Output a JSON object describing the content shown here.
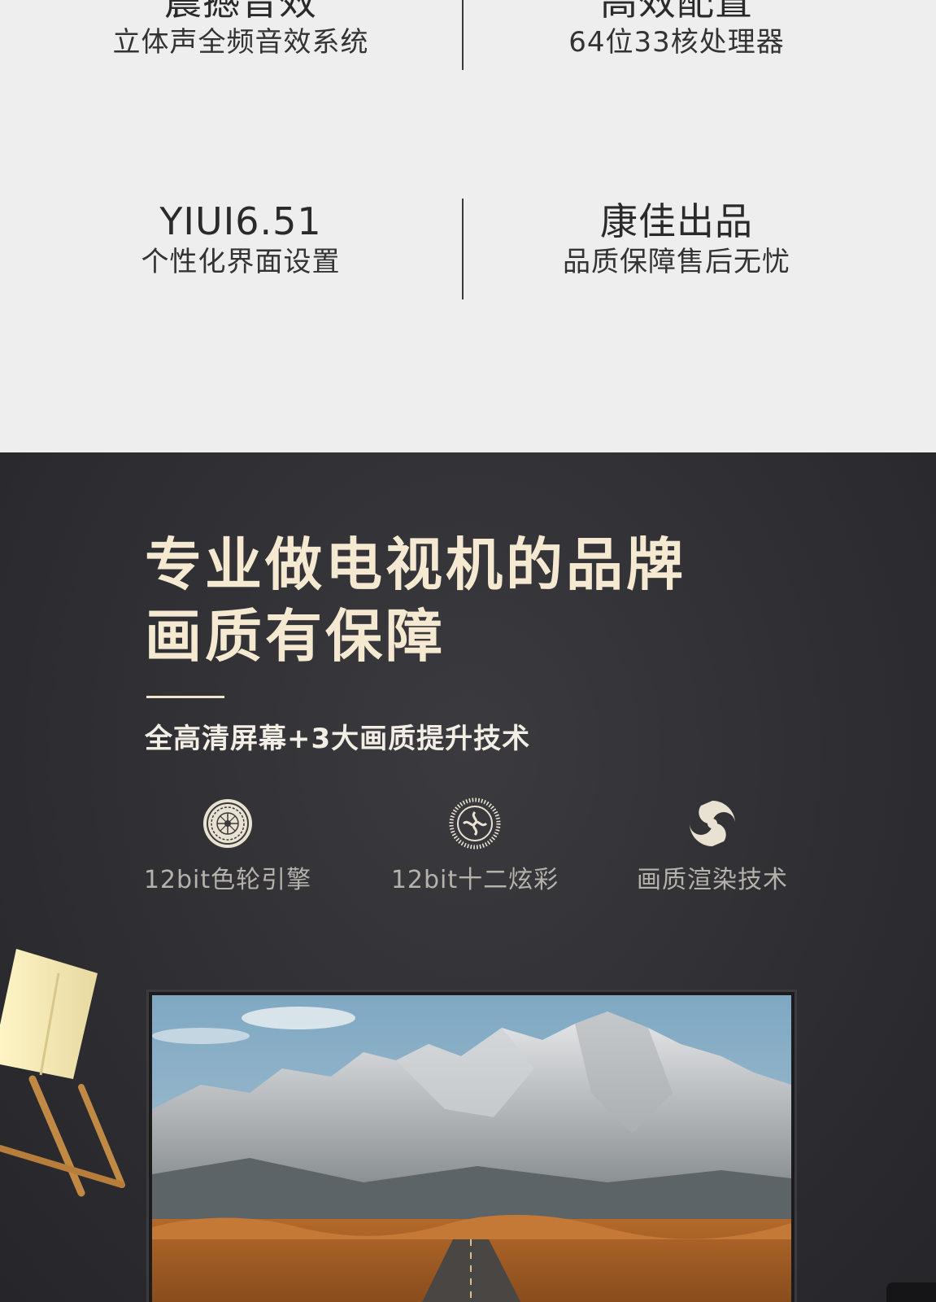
{
  "features": [
    {
      "title": "震撼音效",
      "subtitle": "立体声全频音效系统"
    },
    {
      "title": "高效配置",
      "subtitle": "64位33核处理器"
    },
    {
      "title": "YIUI6.51",
      "subtitle": "个性化界面设置"
    },
    {
      "title": "康佳出品",
      "subtitle": "品质保障售后无忧"
    }
  ],
  "promo": {
    "headline_line1": "专业做电视机的品牌",
    "headline_line2": "画质有保障",
    "subline": "全高清屏幕+3大画质提升技术",
    "techs": [
      {
        "icon": "color-wheel-icon",
        "label": "12bit色轮引擎"
      },
      {
        "icon": "swirl-color-icon",
        "label": "12bit十二炫彩"
      },
      {
        "icon": "yin-yang-render-icon",
        "label": "画质渲染技术"
      }
    ]
  },
  "colors": {
    "light_bg": "#eeeeee",
    "dark_bg": "#2f2f33",
    "headline": "#f5ead1",
    "tech_label": "#b5b2ab"
  }
}
